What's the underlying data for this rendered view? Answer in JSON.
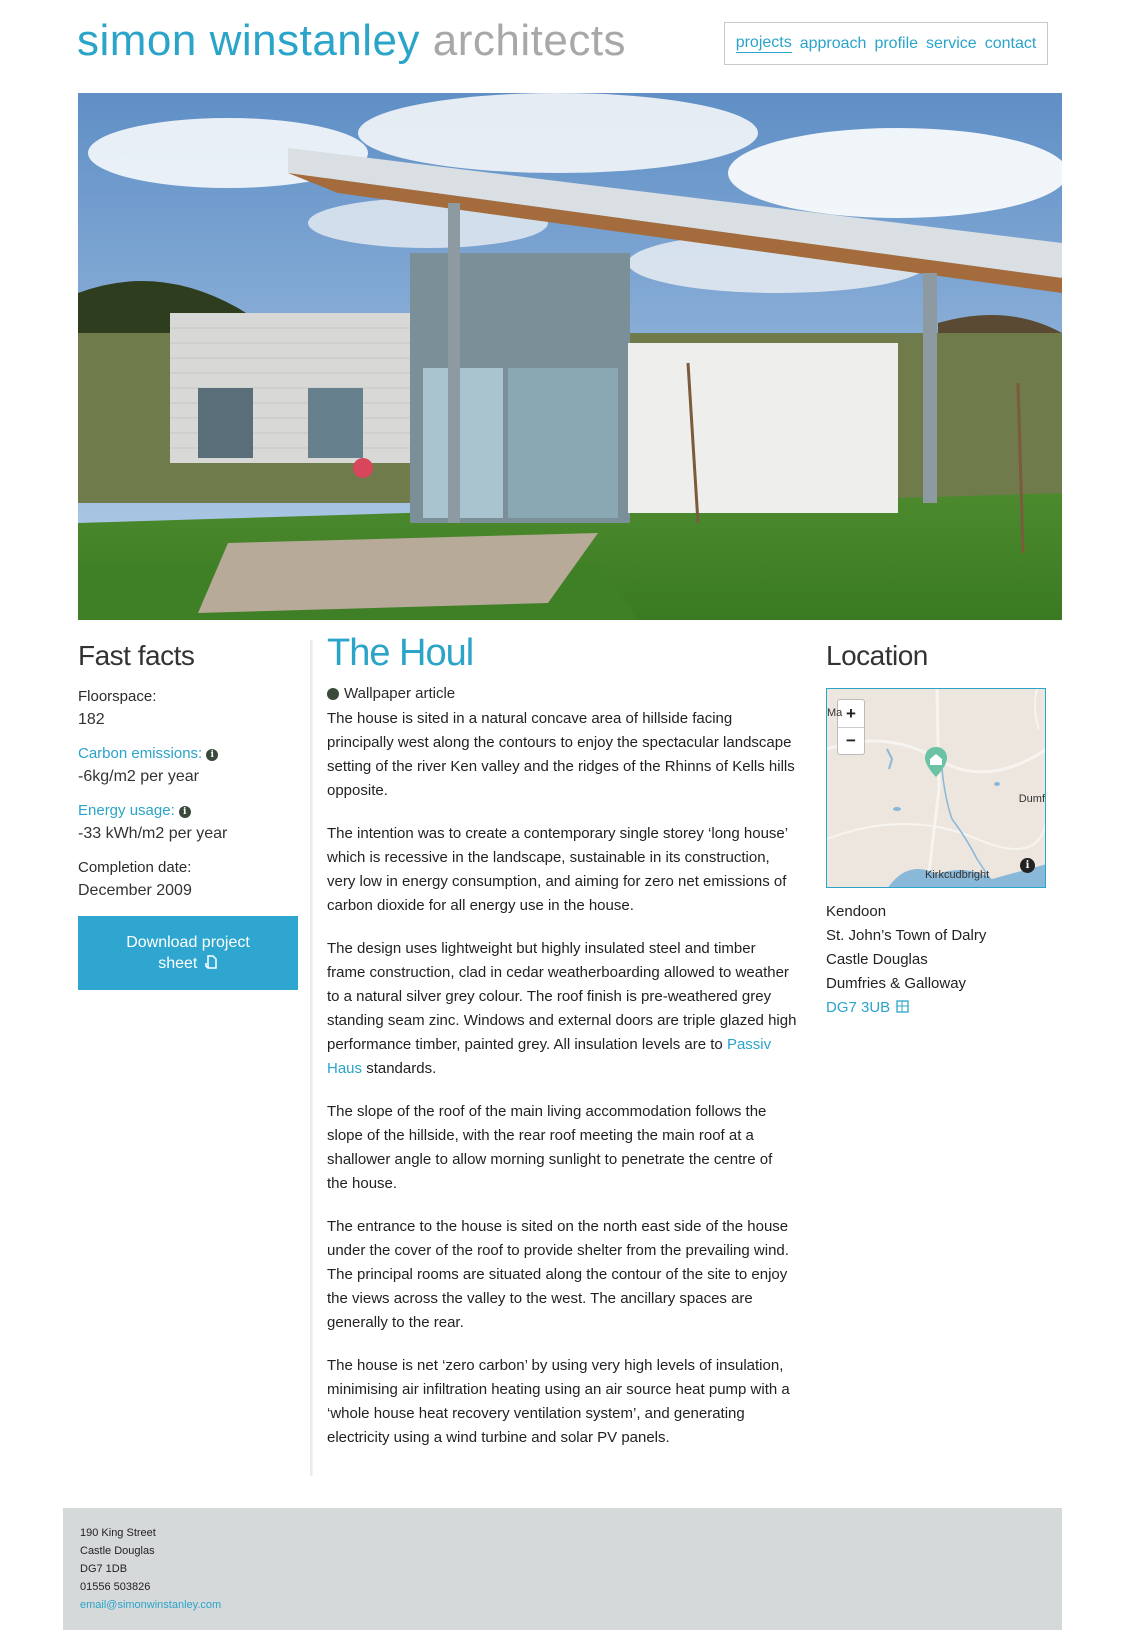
{
  "header": {
    "brand": "simon winstanley",
    "brand_suffix": "architects",
    "nav": [
      "projects",
      "approach",
      "profile",
      "service",
      "contact"
    ],
    "active_nav": "projects"
  },
  "facts": {
    "heading": "Fast facts",
    "floorspace_label": "Floorspace:",
    "floorspace_value": "182",
    "carbon_label": "Carbon emissions:",
    "carbon_value": "-6kg/m2 per year",
    "energy_label": "Energy usage:",
    "energy_value": "-33 kWh/m2 per year",
    "completion_label": "Completion date:",
    "completion_value": "December 2009",
    "download_line1": "Download project",
    "download_line2": "sheet"
  },
  "article": {
    "title": "The Houl",
    "wallpaper_link": "Wallpaper article",
    "p1": "The house is sited in a natural concave area of hillside facing principally west along the contours to enjoy the spectacular landscape setting of the river Ken valley and the ridges of the Rhinns of Kells hills opposite.",
    "p2": "The intention was to create a contemporary single storey ‘long house’ which is recessive in the landscape, sustainable in its construction, very low in energy consumption, and aiming for zero net emissions of carbon dioxide for all energy use in the house.",
    "p3_before": "The design uses lightweight but highly insulated steel and timber frame construction, clad in cedar weatherboarding allowed to weather to a natural silver grey colour. The roof finish is pre-weathered grey standing seam zinc. Windows and external doors are triple glazed high performance timber, painted grey. All insulation levels are to ",
    "p3_link": "Passiv Haus",
    "p3_after": " standards.",
    "p4": "The slope of the roof of the main living accommodation follows the slope of the hillside, with the rear roof meeting the main roof at a shallower angle to allow morning sunlight to penetrate the centre of the house.",
    "p5": "The entrance to the house is sited on the north east side of the house under the cover of the roof to provide shelter from the prevailing wind. The principal rooms are situated along the contour of the site to enjoy the views across the valley to the west. The ancillary spaces are generally to the rear.",
    "p6": "The house is net ‘zero carbon’ by using very high levels of insulation, minimising air infiltration heating using an air source heat pump with a ‘whole house heat recovery ventilation system’, and generating electricity using a wind turbine and solar PV panels."
  },
  "location": {
    "heading": "Location",
    "zoom_in": "+",
    "zoom_out": "−",
    "map_label_top": "Ma",
    "map_label_right": "Dumf",
    "map_label_bottom": "Kirkcudbright",
    "map_info": "i",
    "address": [
      "Kendoon",
      "St. John’s Town of Dalry",
      "Castle Douglas",
      "Dumfries & Galloway"
    ],
    "postcode": "DG7 3UB"
  },
  "footer": {
    "lines": [
      "190 King Street",
      "Castle Douglas",
      "DG7 1DB",
      "01556 503826"
    ],
    "email": "email@simonwinstanley.com"
  },
  "colors": {
    "accent": "#2aa4c9",
    "button": "#2ea6cf",
    "footer_bg": "#d6d9da"
  },
  "icons": {
    "info": "info-icon",
    "globe": "globe-icon",
    "download": "pdf-download-icon",
    "postcode_map": "map-icon",
    "map_marker": "home-marker-icon"
  }
}
